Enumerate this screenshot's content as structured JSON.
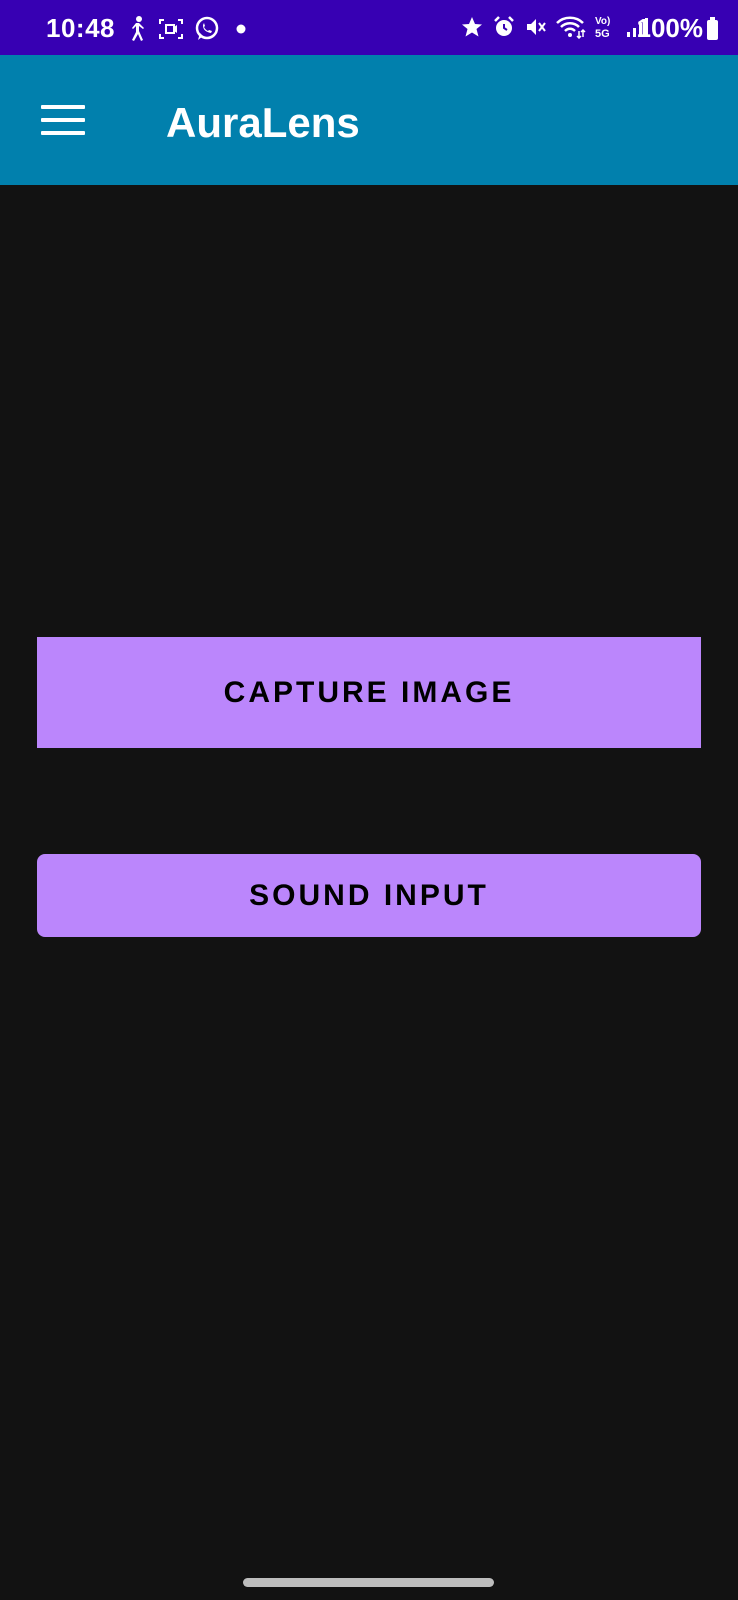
{
  "status_bar": {
    "time": "10:48",
    "battery_text": "100%",
    "left_icons": [
      "walking-icon",
      "screen-recorder-icon",
      "whatsapp-icon",
      "notification-dot-icon"
    ],
    "right_icons": [
      "star-icon",
      "alarm-icon",
      "mute-icon",
      "wifi-icon",
      "volte-5g-icon",
      "signal-icon",
      "battery-icon"
    ]
  },
  "app_bar": {
    "title": "AuraLens",
    "menu_icon": "hamburger-menu-icon"
  },
  "main": {
    "capture_label": "CAPTURE IMAGE",
    "sound_label": "SOUND INPUT"
  },
  "colors": {
    "status_bar": "#3700b3",
    "app_bar": "#0180ad",
    "background": "#121212",
    "button": "#bb86fc"
  }
}
